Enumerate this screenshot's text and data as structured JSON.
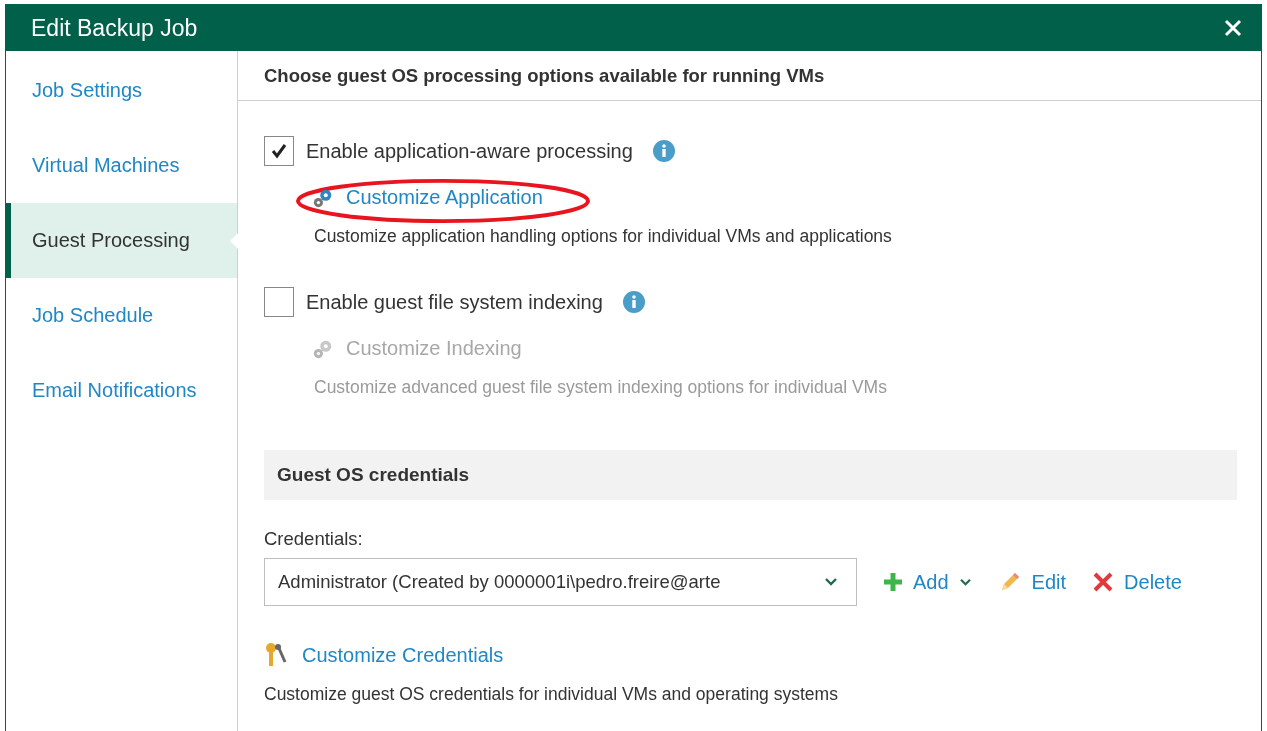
{
  "window": {
    "title": "Edit Backup Job"
  },
  "sidebar": {
    "items": [
      {
        "label": "Job Settings",
        "selected": false
      },
      {
        "label": "Virtual Machines",
        "selected": false
      },
      {
        "label": "Guest Processing",
        "selected": true
      },
      {
        "label": "Job Schedule",
        "selected": false
      },
      {
        "label": "Email Notifications",
        "selected": false
      }
    ]
  },
  "header": "Choose guest OS processing options available for running VMs",
  "options": [
    {
      "label": "Enable application-aware processing",
      "checked": true,
      "link": "Customize Application",
      "link_disabled": false,
      "highlighted": true,
      "description": "Customize application handling options for individual VMs and applications"
    },
    {
      "label": "Enable guest file system indexing",
      "checked": false,
      "link": "Customize Indexing",
      "link_disabled": true,
      "highlighted": false,
      "description": "Customize advanced guest file system indexing options for individual VMs"
    }
  ],
  "credentials_section": {
    "title": "Guest OS credentials",
    "field_label": "Credentials:",
    "value": "Administrator (Created by 0000001i\\pedro.freire@arte",
    "actions": [
      {
        "kind": "add",
        "label": "Add"
      },
      {
        "kind": "edit",
        "label": "Edit"
      },
      {
        "kind": "delete",
        "label": "Delete"
      }
    ],
    "link": "Customize Credentials",
    "description": "Customize guest OS credentials for individual VMs and operating systems"
  }
}
